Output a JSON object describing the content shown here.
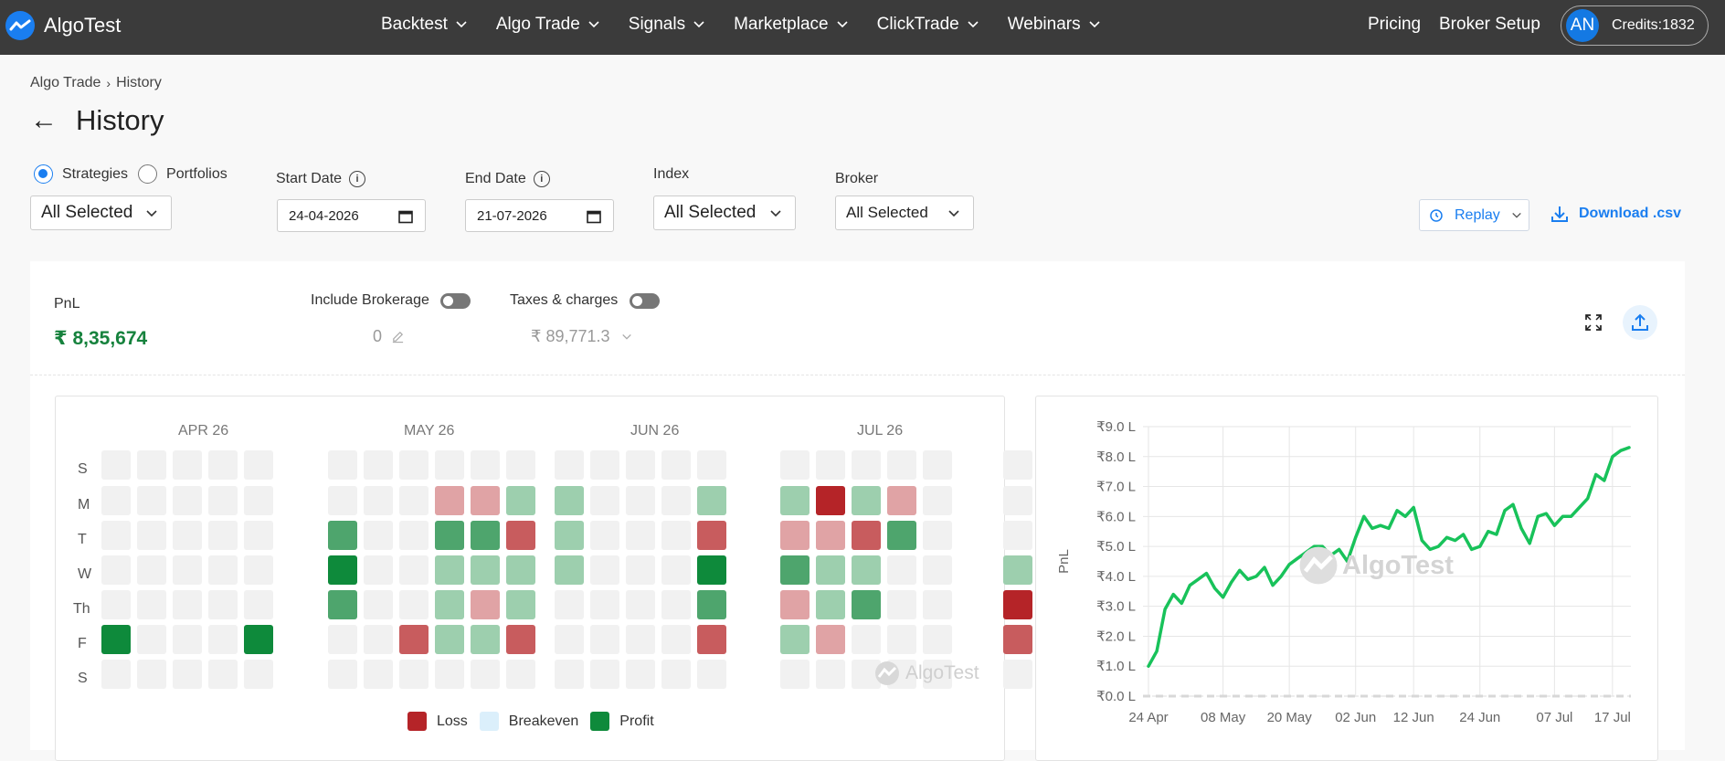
{
  "nav": {
    "brand": "AlgoTest",
    "menu": [
      "Backtest",
      "Algo Trade",
      "Signals",
      "Marketplace",
      "ClickTrade",
      "Webinars"
    ],
    "pricing": "Pricing",
    "broker_setup": "Broker Setup",
    "avatar": "AN",
    "credits": "Credits:1832"
  },
  "breadcrumb": {
    "parent": "Algo Trade",
    "sep": "›",
    "current": "History"
  },
  "page": {
    "back": "←",
    "title": "History"
  },
  "filters": {
    "radio_strategies": "Strategies",
    "radio_portfolios": "Portfolios",
    "strategies_select": "All Selected",
    "start_label": "Start Date",
    "start_value": "24-04-2026",
    "end_label": "End Date",
    "end_value": "21-07-2026",
    "index_label": "Index",
    "index_select": "All Selected",
    "broker_label": "Broker",
    "broker_select": "All Selected",
    "info": "i",
    "replay": "Replay",
    "download": "Download .csv"
  },
  "summary": {
    "pnl_label": "PnL",
    "pnl_value": "₹ 8,35,674",
    "brokerage_label": "Include Brokerage",
    "brokerage_value": "0",
    "taxes_label": "Taxes & charges",
    "taxes_value": "₹ 89,771.3"
  },
  "heatmap": {
    "months": [
      "APR 26",
      "MAY 26",
      "JUN 26",
      "JUL 26"
    ],
    "days": [
      "S",
      "M",
      "T",
      "W",
      "Th",
      "F",
      "S"
    ],
    "legend": {
      "loss": "Loss",
      "breakeven": "Breakeven",
      "profit": "Profit"
    },
    "colors": {
      "empty": "#f1f1f1",
      "loss_strong": "#b52428",
      "loss_mid": "#c85c5e",
      "loss_light": "#e0a3a5",
      "profit_light": "#9dcfae",
      "profit_mid": "#4ea56d",
      "profit_strong": "#0e8a3b",
      "breakeven": "#dbeffb"
    },
    "weeks": [
      [
        "e",
        "e",
        "e",
        "e",
        "e",
        "p1",
        "e"
      ],
      [
        "e",
        "e",
        "e",
        "e",
        "e",
        "e",
        "e"
      ],
      [
        "e",
        "e",
        "e",
        "e",
        "e",
        "e",
        "e"
      ],
      [
        "e",
        "e",
        "e",
        "e",
        "e",
        "e",
        "e"
      ],
      [
        "e",
        "e",
        "e",
        "e",
        "e",
        "p3",
        "e"
      ],
      [
        "e",
        "e",
        "p2",
        "p3",
        "p2",
        "e",
        "e"
      ],
      [
        "e",
        "e",
        "e",
        "e",
        "e",
        "e",
        "e"
      ],
      [
        "e",
        "e",
        "e",
        "e",
        "e",
        "l2",
        "e"
      ],
      [
        "e",
        "l1",
        "p2",
        "g1",
        "g1",
        "g1",
        "e"
      ],
      [
        "e",
        "l1",
        "p2",
        "g1",
        "l1",
        "g1",
        "e"
      ],
      [
        "e",
        "g1",
        "l2",
        "g1",
        "g1",
        "l2",
        "e"
      ],
      [
        "e",
        "g1",
        "g1",
        "g1",
        "e",
        "e",
        "e"
      ],
      [
        "e",
        "e",
        "e",
        "e",
        "e",
        "e",
        "e"
      ],
      [
        "e",
        "e",
        "e",
        "e",
        "e",
        "e",
        "e"
      ],
      [
        "e",
        "e",
        "e",
        "e",
        "e",
        "e",
        "e"
      ],
      [
        "e",
        "g1",
        "l2",
        "p3",
        "p2",
        "l2",
        "e"
      ],
      [
        "e",
        "g1",
        "l1",
        "p2",
        "l1",
        "g1",
        "e"
      ],
      [
        "e",
        "l3",
        "l1",
        "g1",
        "g1",
        "l1",
        "e"
      ],
      [
        "e",
        "g1",
        "l2",
        "g1",
        "p2",
        "e",
        "e"
      ],
      [
        "e",
        "l1",
        "p2",
        "e",
        "e",
        "e",
        "e"
      ],
      [
        "e",
        "e",
        "e",
        "e",
        "e",
        "e",
        "e"
      ],
      [
        "e",
        "e",
        "e",
        "g1",
        "l3",
        "l2",
        "e"
      ],
      [
        "e",
        "e",
        "e",
        "l2",
        "g1",
        "l1",
        "e"
      ],
      [
        "e",
        "p3",
        "g1",
        "p2",
        "l1",
        "p2",
        "e"
      ],
      [
        "e",
        "g1",
        "g1",
        "e",
        "e",
        "e",
        "e"
      ],
      [
        "e",
        "e",
        "e",
        "e",
        "e",
        "e",
        "e"
      ]
    ],
    "watermark": "AlgoTest"
  },
  "chart_data": {
    "type": "line",
    "ylabel": "PnL",
    "y_ticks": [
      "₹0.0 L",
      "₹1.0 L",
      "₹2.0 L",
      "₹3.0 L",
      "₹4.0 L",
      "₹5.0 L",
      "₹6.0 L",
      "₹7.0 L",
      "₹8.0 L",
      "₹9.0 L"
    ],
    "x_ticks": [
      "24 Apr",
      "08 May",
      "20 May",
      "02 Jun",
      "12 Jun",
      "24 Jun",
      "07 Jul",
      "17 Jul"
    ],
    "x_tick_index": [
      0,
      9,
      17,
      25,
      32,
      40,
      49,
      56
    ],
    "ylim": [
      0,
      9
    ],
    "color": "#18c25a",
    "series": [
      {
        "values": [
          1.0,
          1.5,
          2.9,
          3.4,
          3.1,
          3.7,
          3.9,
          4.1,
          3.6,
          3.3,
          3.8,
          4.2,
          3.9,
          4.0,
          4.3,
          3.7,
          4.0,
          4.4,
          4.6,
          4.8,
          5.0,
          5.0,
          4.7,
          4.9,
          4.5,
          5.3,
          6.0,
          5.6,
          5.7,
          5.6,
          6.2,
          6.0,
          6.3,
          5.2,
          4.9,
          5.0,
          5.3,
          5.2,
          5.4,
          4.9,
          5.0,
          5.5,
          5.4,
          6.2,
          6.4,
          5.6,
          5.1,
          6.0,
          6.1,
          5.7,
          6.0,
          6.0,
          6.3,
          6.6,
          7.4,
          7.2,
          8.0,
          8.2,
          8.3
        ]
      }
    ],
    "watermark": "AlgoTest"
  }
}
